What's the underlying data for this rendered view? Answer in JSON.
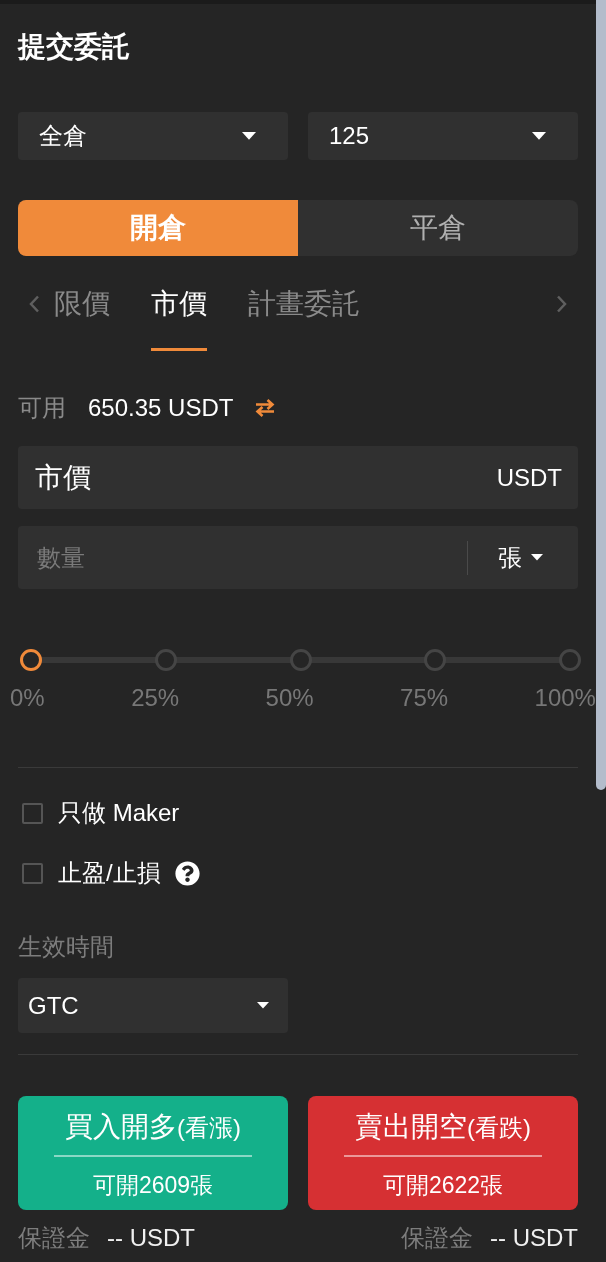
{
  "title": "提交委託",
  "selectors": [
    {
      "value": "全倉"
    },
    {
      "value": "125"
    }
  ],
  "position_tabs": [
    {
      "label": "開倉",
      "selected": true
    },
    {
      "label": "平倉",
      "selected": false
    }
  ],
  "order_tabs": [
    {
      "label": "限價",
      "selected": false
    },
    {
      "label": "市價",
      "selected": true
    },
    {
      "label": "計畫委託",
      "selected": false
    }
  ],
  "available": {
    "label": "可用",
    "value": "650.35 USDT"
  },
  "price_field": {
    "value": "市價",
    "unit": "USDT"
  },
  "quantity_field": {
    "placeholder": "數量",
    "unit": "張"
  },
  "slider": {
    "level": 0,
    "marks": [
      "0%",
      "25%",
      "50%",
      "75%",
      "100%"
    ]
  },
  "options": [
    {
      "label": "只做 Maker",
      "checked": false,
      "help": false
    },
    {
      "label": "止盈/止損",
      "checked": false,
      "help": true
    }
  ],
  "time_in_force": {
    "label": "生效時間",
    "value": "GTC"
  },
  "actions": [
    {
      "kind": "buy",
      "label": "買入開多",
      "hint": "(看漲)",
      "capacity": "可開2609張",
      "margin_label": "保證金",
      "margin_value": "-- USDT"
    },
    {
      "kind": "sell",
      "label": "賣出開空",
      "hint": "(看跌)",
      "capacity": "可開2622張",
      "margin_label": "保證金",
      "margin_value": "-- USDT"
    }
  ]
}
